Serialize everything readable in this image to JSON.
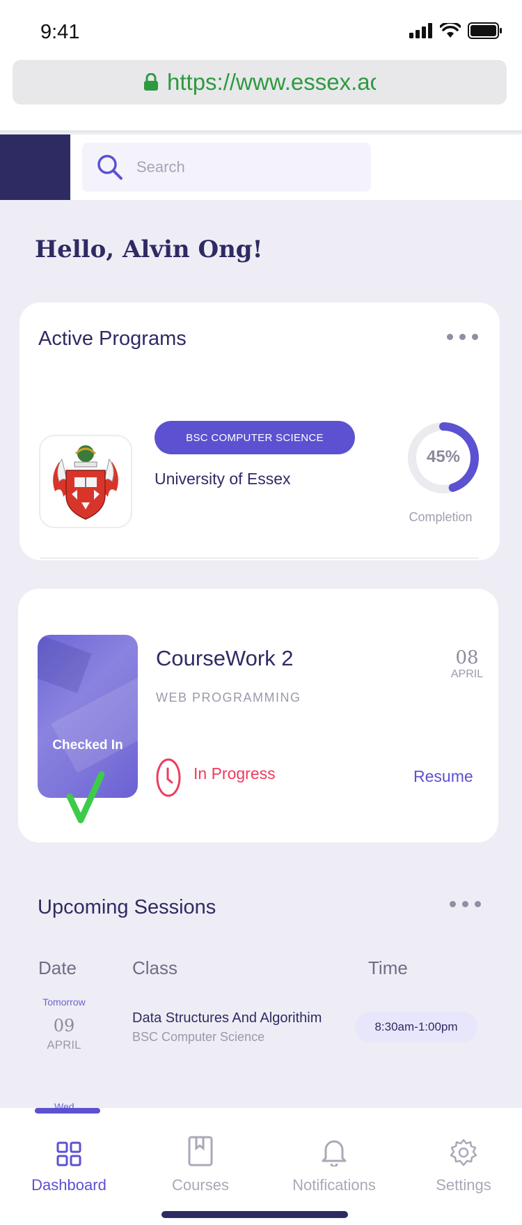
{
  "status_bar": {
    "time": "9:41"
  },
  "browser": {
    "url": "https://www.essex.ac"
  },
  "search": {
    "placeholder": "Search"
  },
  "greeting": "Hello, Alvin Ong!",
  "active_programs": {
    "title": "Active Programs",
    "program_name": "BSC COMPUTER SCIENCE",
    "university": "University of Essex",
    "completion_percent": 45,
    "completion_text": "45%",
    "completion_label": "Completion"
  },
  "coursework": {
    "title": "CourseWork 2",
    "subject": "WEB PROGRAMMING",
    "badge": "Checked In",
    "date_day": "08",
    "date_month": "APRIL",
    "status": "In Progress",
    "action": "Resume"
  },
  "upcoming": {
    "title": "Upcoming Sessions",
    "headers": {
      "date": "Date",
      "class": "Class",
      "time": "Time"
    },
    "sessions": [
      {
        "relative_day": "Tomorrow",
        "day": "09",
        "month": "APRIL",
        "class_name": "Data Structures And Algorithim",
        "program": "BSC Computer Science",
        "time": "8:30am-1:00pm"
      }
    ],
    "next_relative_day": "Wed"
  },
  "tabs": [
    {
      "label": "Dashboard",
      "icon": "grid-icon",
      "active": true
    },
    {
      "label": "Courses",
      "icon": "bookmark-book-icon",
      "active": false
    },
    {
      "label": "Notifications",
      "icon": "bell-icon",
      "active": false
    },
    {
      "label": "Settings",
      "icon": "gear-icon",
      "active": false
    }
  ],
  "colors": {
    "accent": "#5c51d0",
    "navy": "#2e2b63",
    "danger": "#ef3a5d",
    "success": "#3ecb4a",
    "url_green": "#2e9a40"
  }
}
